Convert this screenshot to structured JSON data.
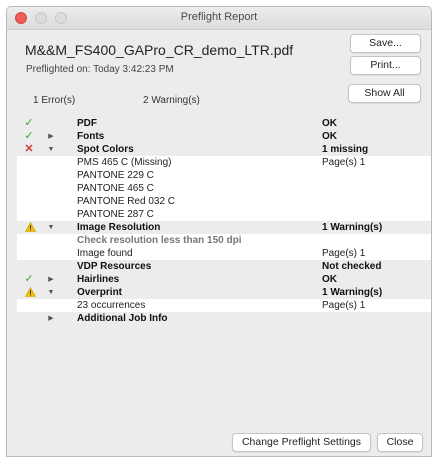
{
  "window": {
    "title": "Preflight Report"
  },
  "header": {
    "filename": "M&&M_FS400_GAPro_CR_demo_LTR.pdf",
    "preflighted": "Preflighted on: Today 3:42:23 PM",
    "save_label": "Save...",
    "print_label": "Print...",
    "show_all_label": "Show All"
  },
  "summary": {
    "errors": "1 Error(s)",
    "warnings": "2 Warning(s)"
  },
  "report": {
    "pdf": {
      "label": "PDF",
      "value": "OK"
    },
    "fonts": {
      "label": "Fonts",
      "value": "OK"
    },
    "spot_colors": {
      "label": "Spot Colors",
      "value": "1 missing",
      "items": [
        {
          "label": "PMS 465 C (Missing)",
          "value": "Page(s) 1"
        },
        {
          "label": "PANTONE 229 C"
        },
        {
          "label": "PANTONE 465 C"
        },
        {
          "label": "PANTONE Red 032 C"
        },
        {
          "label": "PANTONE 287 C"
        }
      ]
    },
    "image_resolution": {
      "label": "Image Resolution",
      "value": "1 Warning(s)",
      "check_label": "Check resolution less than 150 dpi",
      "found_label": "Image found",
      "found_value": "Page(s) 1"
    },
    "vdp": {
      "label": "VDP Resources",
      "value": "Not checked"
    },
    "hairlines": {
      "label": "Hairlines",
      "value": "OK"
    },
    "overprint": {
      "label": "Overprint",
      "value": "1 Warning(s)",
      "occ_label": "23 occurrences",
      "occ_value": "Page(s) 1"
    },
    "job_info": {
      "label": "Additional Job Info"
    }
  },
  "footer": {
    "change_settings_label": "Change Preflight Settings",
    "close_label": "Close"
  },
  "icons": {
    "ok": "checkmark-icon",
    "error": "x-icon",
    "warning": "warning-triangle-icon",
    "collapsed": "disclosure-right-icon",
    "expanded": "disclosure-down-icon"
  },
  "colors": {
    "ok": "#3aa33a",
    "error": "#d33b30",
    "warning": "#f2c200",
    "close_button": "#ee5c55"
  }
}
